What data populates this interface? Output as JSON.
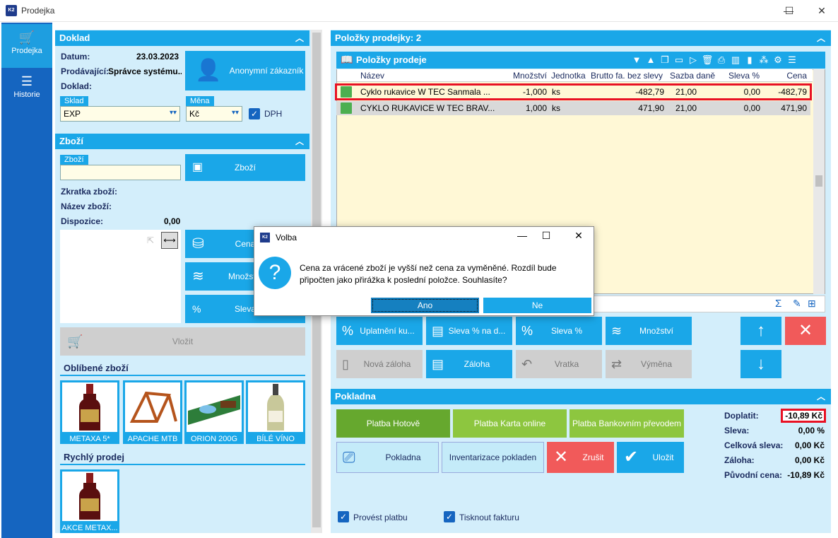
{
  "window": {
    "title": "Prodejka",
    "minimize": "—",
    "maximize": "☐",
    "close": "✕"
  },
  "nav": {
    "items": [
      {
        "label": "Prodejka",
        "icon": "cart-icon"
      },
      {
        "label": "Historie",
        "icon": "list-icon"
      }
    ]
  },
  "doklad": {
    "title": "Doklad",
    "datum_label": "Datum:",
    "datum_value": "23.03.2023",
    "prodavajici_label": "Prodávající:",
    "prodavajici_value": "Správce systému...",
    "doklad_label": "Doklad:",
    "customer_button": "Anonymní zákazník",
    "sklad_label": "Sklad",
    "sklad_value": "EXP",
    "mena_label": "Měna",
    "mena_value": "Kč",
    "dph_label": "DPH",
    "dph_checked": true
  },
  "zbozi": {
    "title": "Zboží",
    "input_label": "Zboží",
    "input_value": "",
    "button": "Zboží",
    "zkratka_label": "Zkratka zboží:",
    "nazev_label": "Název zboží:",
    "dispozice_label": "Dispozice:",
    "dispozice_value": "0,00",
    "cena_button": "Cena",
    "mnozstvi_button": "Množství",
    "sleva_button": "Sleva",
    "vlozit_button": "Vložit",
    "oblibene_title": "Oblíbené zboží",
    "oblibene": [
      "METAXA 5*",
      "APACHE MTB",
      "ORION 200G",
      "BÍLÉ VÍNO"
    ],
    "rychly_title": "Rychlý prodej",
    "rychly": [
      "AKCE METAX..."
    ]
  },
  "polozky": {
    "panel_title": "Položky prodejky: 2",
    "grid_title": "Položky prodeje",
    "columns": [
      "Název",
      "Množství",
      "Jednotka",
      "Brutto fa. bez slevy",
      "Sazba daně",
      "Sleva %",
      "Cena"
    ],
    "rows": [
      [
        "Cyklo rukavice W TEC Sanmala ...",
        "-1,000",
        "ks",
        "-482,79",
        "21,00",
        "0,00",
        "-482,79"
      ],
      [
        "CYKLO RUKAVICE W TEC BRAV...",
        "1,000",
        "ks",
        "471,90",
        "21,00",
        "0,00",
        "471,90"
      ]
    ]
  },
  "actions": {
    "uplatneni": "Uplatnění ku...",
    "sleva_na_d": "Sleva % na d...",
    "sleva": "Sleva %",
    "mnozstvi": "Množství",
    "nova_zaloha": "Nová záloha",
    "zaloha": "Záloha",
    "vratka": "Vratka",
    "vymena": "Výměna"
  },
  "pokladna": {
    "title": "Pokladna",
    "platba_hotove": "Platba Hotově",
    "platba_karta": "Platba Karta online",
    "platba_bank": "Platba Bankovním převodem",
    "pokladna_btn": "Pokladna",
    "inventarizace": "Inventarizace pokladen",
    "zrusit": "Zrušit",
    "ulozit": "Uložit",
    "doplatit_label": "Doplatit:",
    "doplatit_value": "-10,89 Kč",
    "sleva_label": "Sleva:",
    "sleva_value": "0,00 %",
    "celkova_label": "Celková sleva:",
    "celkova_value": "0,00 Kč",
    "zaloha_label": "Záloha:",
    "zaloha_value": "0,00 Kč",
    "puvodni_label": "Původní cena:",
    "puvodni_value": "-10,89 Kč",
    "provest_platbu": "Provést platbu",
    "tisknout_fakturu": "Tisknout fakturu"
  },
  "dialog": {
    "title": "Volba",
    "message": "Cena za vrácené zboží je vyšší než cena za vyměněné. Rozdíl bude připočten jako přirážka k poslední položce. Souhlasíte?",
    "yes": "Ano",
    "no": "Ne"
  },
  "colors": {
    "accent": "#1aa7e8",
    "nav": "#1565c0",
    "highlight": "#e81123"
  }
}
